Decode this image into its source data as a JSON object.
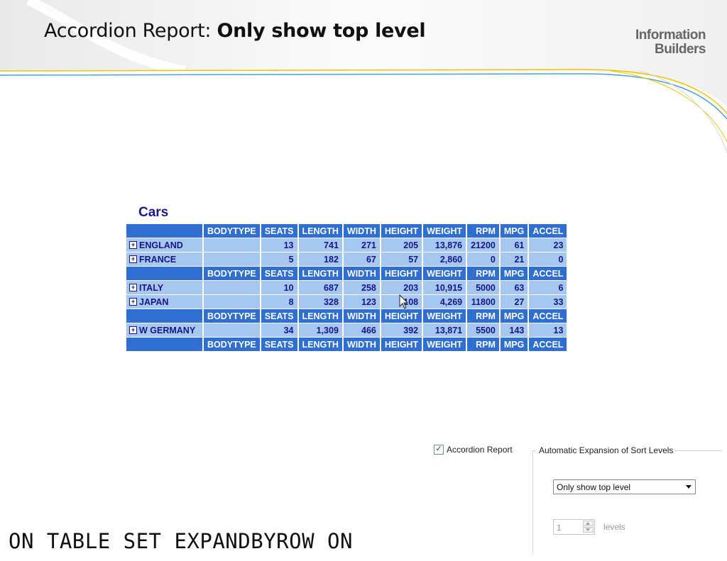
{
  "slide": {
    "title_prefix": "Accordion Report: ",
    "title_bold": "Only show top level",
    "logo_line1": "Information",
    "logo_line2": "Builders"
  },
  "report": {
    "title": "Cars",
    "columns": [
      "BODYTYPE",
      "SEATS",
      "LENGTH",
      "WIDTH",
      "HEIGHT",
      "WEIGHT",
      "RPM",
      "MPG",
      "ACCEL"
    ],
    "rows": [
      {
        "type": "header"
      },
      {
        "type": "data",
        "label": "ENGLAND",
        "values": [
          "",
          "13",
          "741",
          "271",
          "205",
          "13,876",
          "21200",
          "61",
          "23"
        ]
      },
      {
        "type": "data",
        "label": "FRANCE",
        "values": [
          "",
          "5",
          "182",
          "67",
          "57",
          "2,860",
          "0",
          "21",
          "0"
        ]
      },
      {
        "type": "header"
      },
      {
        "type": "data",
        "label": "ITALY",
        "values": [
          "",
          "10",
          "687",
          "258",
          "203",
          "10,915",
          "5000",
          "63",
          "6"
        ]
      },
      {
        "type": "data",
        "label": "JAPAN",
        "values": [
          "",
          "8",
          "328",
          "123",
          "108",
          "4,269",
          "11800",
          "27",
          "33"
        ]
      },
      {
        "type": "header"
      },
      {
        "type": "data",
        "label": "W GERMANY",
        "values": [
          "",
          "34",
          "1,309",
          "466",
          "392",
          "13,871",
          "5500",
          "143",
          "13"
        ]
      },
      {
        "type": "header"
      }
    ],
    "expand_icon": "plus-box-icon",
    "colors": {
      "header_bg": "#2f6fd1",
      "row_bg": "#a6c8f0",
      "row_text": "#15158a"
    }
  },
  "options": {
    "accordion_label": "Accordion Report",
    "accordion_checked": true,
    "group_label": "Automatic Expansion of Sort Levels",
    "expansion_selected": "Only show top level",
    "levels_value": "1",
    "levels_label": "levels"
  },
  "code_line": "ON TABLE SET EXPANDBYROW ON"
}
